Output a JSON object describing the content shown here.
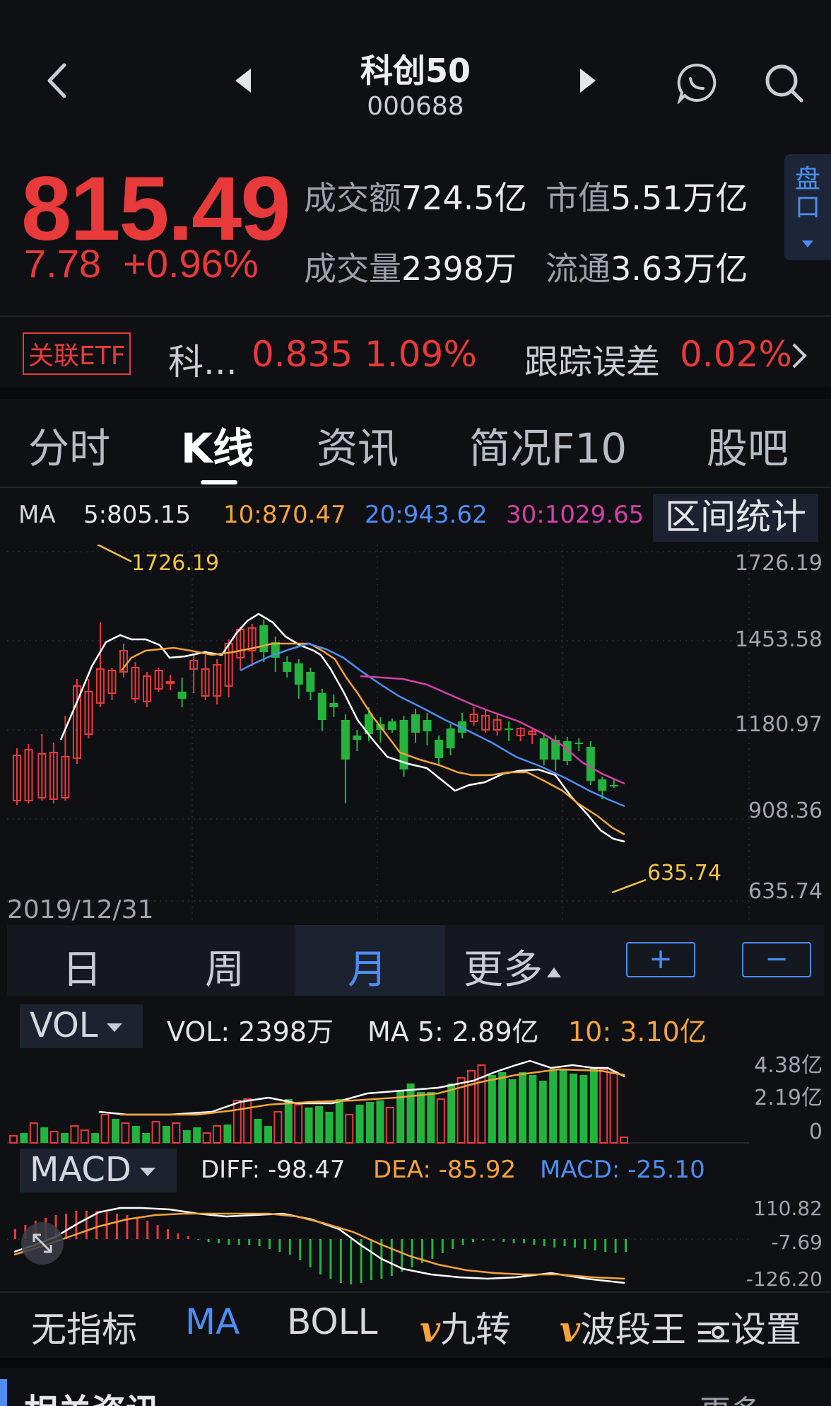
{
  "header": {
    "title": "科创50",
    "code": "000688"
  },
  "quote": {
    "price": "815.49",
    "change": "7.78",
    "change_pct": "+0.96%",
    "turnover_label": "成交额",
    "turnover": "724.5亿",
    "mktcap_label": "市值",
    "mktcap": "5.51万亿",
    "volume_label": "成交量",
    "volume": "2398万",
    "float_label": "流通",
    "float": "3.63万亿",
    "pankou": "盘口"
  },
  "etf": {
    "tag": "关联ETF",
    "name": "科...",
    "price": "0.835",
    "pct": "1.09%",
    "track_label": "跟踪误差",
    "track_value": "0.02%"
  },
  "tabs": [
    "分时",
    "K线",
    "资讯",
    "简况F10",
    "股吧"
  ],
  "ma": {
    "label": "MA",
    "ma5": "5:805.15",
    "ma10": "10:870.47",
    "ma20": "20:943.62",
    "ma30": "30:1029.65",
    "range_stats": "区间统计"
  },
  "colors": {
    "up": "#e83a3a",
    "down": "#22b43c",
    "ma5": "#ffffff",
    "ma10": "#f5a33a",
    "ma20": "#4d8ef5",
    "ma30": "#d63fa8",
    "accent": "#4d8ef5"
  },
  "kline": {
    "y_ticks": [
      "1726.19",
      "1453.58",
      "1180.97",
      "908.36",
      "635.74"
    ],
    "high_label": "1726.19",
    "low_label": "635.74",
    "start_date": "2019/12/31"
  },
  "periods": {
    "day": "日",
    "week": "周",
    "month": "月",
    "more": "更多",
    "zoom_in": "+",
    "zoom_out": "−"
  },
  "vol": {
    "selector": "VOL",
    "vol": "VOL: 2398万",
    "ma5": "MA 5: 2.89亿",
    "ma10": "10: 3.10亿",
    "y_ticks": [
      "4.38亿",
      "2.19亿",
      "0"
    ]
  },
  "macd": {
    "selector": "MACD",
    "diff": "DIFF: -98.47",
    "dea": "DEA: -85.92",
    "macd": "MACD: -25.10",
    "y_ticks": [
      "110.82",
      "-7.69",
      "-126.20"
    ]
  },
  "indicators": {
    "none": "无指标",
    "ma": "MA",
    "boll": "BOLL",
    "nine": "九转",
    "wave": "波段王",
    "settings": "设置"
  },
  "footer": {
    "related": "相关资讯",
    "more": "更多"
  }
}
